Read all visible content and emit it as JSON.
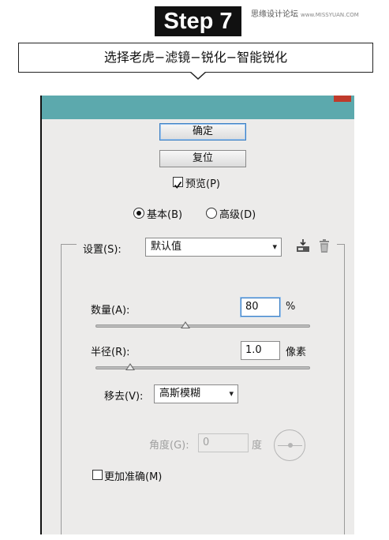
{
  "header": {
    "step_label": "Step 7",
    "watermark_main": "思缘设计论坛",
    "watermark_sub": "www.MISSYUAN.COM",
    "instruction": "选择老虎−滤镜−锐化−智能锐化"
  },
  "dialog": {
    "ok_label": "确定",
    "reset_label": "复位",
    "preview": {
      "label": "预览(P)",
      "checked": true
    },
    "mode": {
      "options": [
        "基本(B)",
        "高级(D)"
      ],
      "selected": "基本(B)"
    },
    "settings": {
      "label": "设置(S):",
      "value": "默认值"
    },
    "amount": {
      "label": "数量(A):",
      "value": "80",
      "unit": "%",
      "slider_fraction": 0.42
    },
    "radius": {
      "label": "半径(R):",
      "value": "1.0",
      "unit": "像素",
      "slider_fraction": 0.16
    },
    "remove": {
      "label": "移去(V):",
      "value": "高斯模糊"
    },
    "angle": {
      "label": "角度(G):",
      "value": "0",
      "unit": "度",
      "enabled": false
    },
    "more_accurate": {
      "label": "更加准确(M)",
      "checked": false
    }
  },
  "colors": {
    "titlebar": "#5ca9ad",
    "dialog_bg": "#ecebea",
    "focus_blue": "#3b7fc4"
  },
  "icons": [
    "save-preset-icon",
    "trash-icon",
    "chevron-down-icon",
    "angle-dial-icon"
  ]
}
